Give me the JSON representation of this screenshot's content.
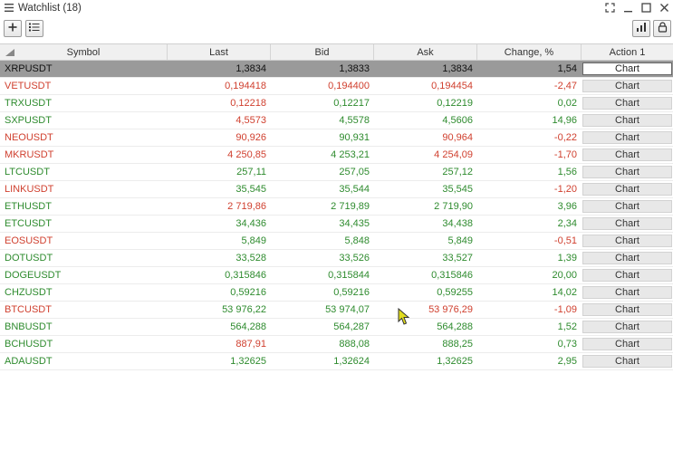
{
  "window": {
    "title": "Watchlist (18)",
    "icons": [
      "menu-icon",
      "fullscreen-icon",
      "minimize-icon",
      "maximize-icon",
      "close-icon"
    ]
  },
  "toolbar": {
    "left_icons": [
      "add-icon",
      "list-icon"
    ],
    "right_icons": [
      "chart-settings-icon",
      "lock-icon"
    ]
  },
  "columns": [
    "Symbol",
    "Last",
    "Bid",
    "Ask",
    "Change, %",
    "Action 1"
  ],
  "colors": {
    "up": "#2e8b2e",
    "down": "#d0402f",
    "neutral": "#222222",
    "selected_bg": "#9a9a9a"
  },
  "rows": [
    {
      "symbol": "XRPUSDT",
      "last": "1,3834",
      "bid": "1,3833",
      "ask": "1,3834",
      "change": "1,54",
      "action": "Chart",
      "dir": "neutral",
      "selected": true
    },
    {
      "symbol": "VETUSDT",
      "last": "0,194418",
      "bid": "0,194400",
      "ask": "0,194454",
      "change": "-2,47",
      "action": "Chart",
      "dir": "down"
    },
    {
      "symbol": "TRXUSDT",
      "last": "0,12218",
      "bid": "0,12217",
      "ask": "0,12219",
      "change": "0,02",
      "action": "Chart",
      "dir": "up",
      "lastdir": "down"
    },
    {
      "symbol": "SXPUSDT",
      "last": "4,5573",
      "bid": "4,5578",
      "ask": "4,5606",
      "change": "14,96",
      "action": "Chart",
      "dir": "up",
      "lastdir": "down"
    },
    {
      "symbol": "NEOUSDT",
      "last": "90,926",
      "bid": "90,931",
      "ask": "90,964",
      "change": "-0,22",
      "action": "Chart",
      "dir": "down",
      "biddir": "up"
    },
    {
      "symbol": "MKRUSDT",
      "last": "4 250,85",
      "bid": "4 253,21",
      "ask": "4 254,09",
      "change": "-1,70",
      "action": "Chart",
      "dir": "down",
      "biddir": "up"
    },
    {
      "symbol": "LTCUSDT",
      "last": "257,11",
      "bid": "257,05",
      "ask": "257,12",
      "change": "1,56",
      "action": "Chart",
      "dir": "up"
    },
    {
      "symbol": "LINKUSDT",
      "last": "35,545",
      "bid": "35,544",
      "ask": "35,545",
      "change": "-1,20",
      "action": "Chart",
      "dir": "down",
      "lastdir": "up",
      "biddir": "up",
      "askdir": "up"
    },
    {
      "symbol": "ETHUSDT",
      "last": "2 719,86",
      "bid": "2 719,89",
      "ask": "2 719,90",
      "change": "3,96",
      "action": "Chart",
      "dir": "up",
      "lastdir": "down"
    },
    {
      "symbol": "ETCUSDT",
      "last": "34,436",
      "bid": "34,435",
      "ask": "34,438",
      "change": "2,34",
      "action": "Chart",
      "dir": "up"
    },
    {
      "symbol": "EOSUSDT",
      "last": "5,849",
      "bid": "5,848",
      "ask": "5,849",
      "change": "-0,51",
      "action": "Chart",
      "dir": "down",
      "lastdir": "up",
      "biddir": "up",
      "askdir": "up"
    },
    {
      "symbol": "DOTUSDT",
      "last": "33,528",
      "bid": "33,526",
      "ask": "33,527",
      "change": "1,39",
      "action": "Chart",
      "dir": "up"
    },
    {
      "symbol": "DOGEUSDT",
      "last": "0,315846",
      "bid": "0,315844",
      "ask": "0,315846",
      "change": "20,00",
      "action": "Chart",
      "dir": "up"
    },
    {
      "symbol": "CHZUSDT",
      "last": "0,59216",
      "bid": "0,59216",
      "ask": "0,59255",
      "change": "14,02",
      "action": "Chart",
      "dir": "up"
    },
    {
      "symbol": "BTCUSDT",
      "last": "53 976,22",
      "bid": "53 974,07",
      "ask": "53 976,29",
      "change": "-1,09",
      "action": "Chart",
      "dir": "down",
      "lastdir": "up",
      "biddir": "up"
    },
    {
      "symbol": "BNBUSDT",
      "last": "564,288",
      "bid": "564,287",
      "ask": "564,288",
      "change": "1,52",
      "action": "Chart",
      "dir": "up"
    },
    {
      "symbol": "BCHUSDT",
      "last": "887,91",
      "bid": "888,08",
      "ask": "888,25",
      "change": "0,73",
      "action": "Chart",
      "dir": "up",
      "lastdir": "down"
    },
    {
      "symbol": "ADAUSDT",
      "last": "1,32625",
      "bid": "1,32624",
      "ask": "1,32625",
      "change": "2,95",
      "action": "Chart",
      "dir": "up"
    }
  ]
}
